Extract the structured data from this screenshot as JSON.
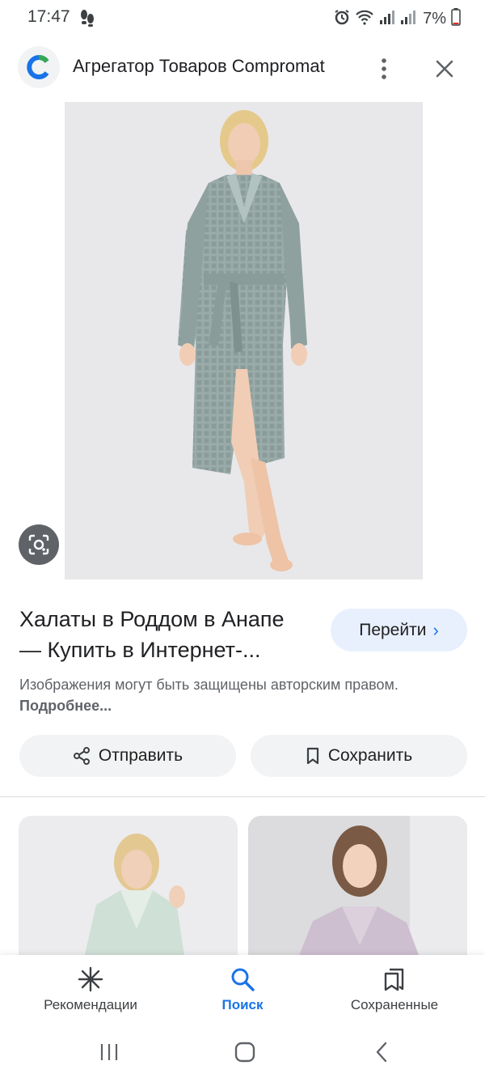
{
  "status_bar": {
    "time": "17:47",
    "battery": "7%"
  },
  "top_bar": {
    "site_title": "Агрегатор Товаров Compromat"
  },
  "result": {
    "title_line1": "Халаты в Роддом в Анапе",
    "title_line2": "— Купить в Интернет-...",
    "visit_label": "Перейти",
    "copyright_text": "Изображения могут быть защищены авторским правом.",
    "copyright_more": "Подробнее..."
  },
  "actions": {
    "share_label": "Отправить",
    "save_label": "Сохранить"
  },
  "bottom_nav": {
    "items": [
      {
        "label": "Рекомендации",
        "icon": "asterisk-icon"
      },
      {
        "label": "Поиск",
        "icon": "search-icon",
        "active": true
      },
      {
        "label": "Сохраненные",
        "icon": "saved-collections-icon"
      }
    ]
  },
  "colors": {
    "accent": "#1a73e8",
    "visit_button_bg": "#e8f0fe",
    "chip_bg": "#f1f3f4",
    "robe_main": "#9aaba9",
    "robe_related_1": "#cfe0d6",
    "robe_related_2": "#cdbfd0"
  }
}
